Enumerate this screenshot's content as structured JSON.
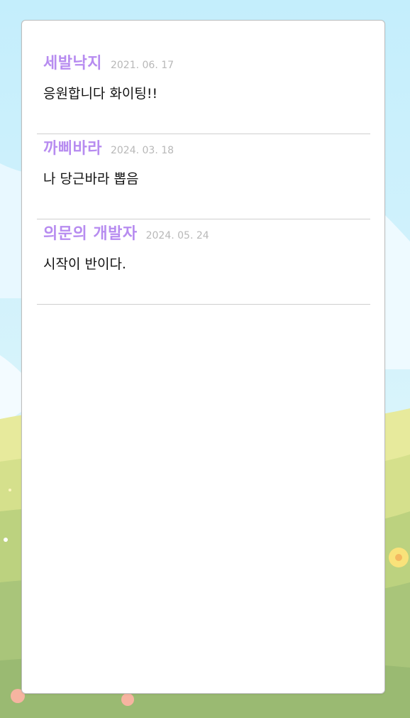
{
  "guestbook": {
    "entries": [
      {
        "name": "세발낙지",
        "date": "2021. 06. 17",
        "message": "응원합니다 화이팅!!"
      },
      {
        "name": "까삐바라",
        "date": "2024. 03. 18",
        "message": "나 당근바라 뽑음"
      },
      {
        "name": "의문의 개발자",
        "date": "2024. 05. 24",
        "message": "시작이 반이다."
      }
    ]
  },
  "colors": {
    "accent": "#b78cf0",
    "date": "#b8b8b8",
    "sky": "#c9effc",
    "grass": "#a9c57a"
  }
}
